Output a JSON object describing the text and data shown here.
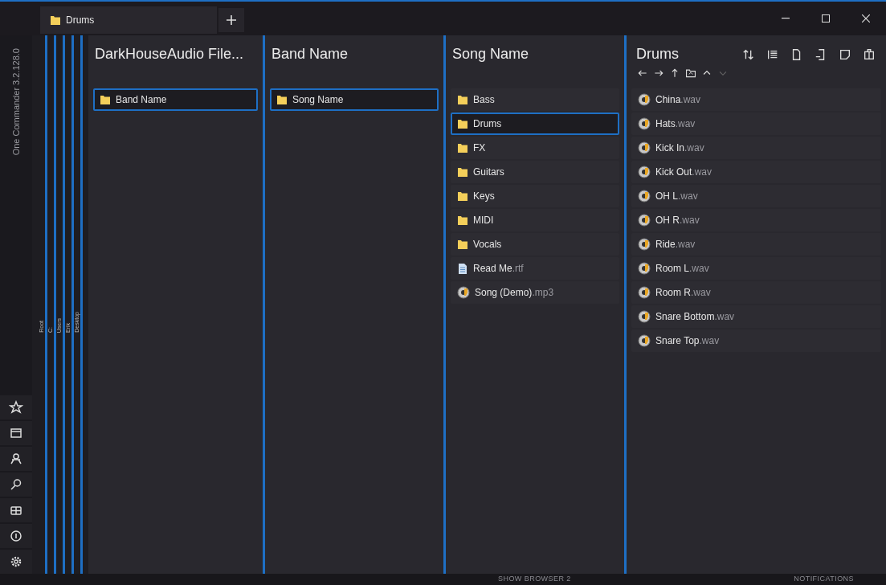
{
  "app": {
    "version_label": "One Commander 3.2.128.0"
  },
  "tabs": [
    {
      "label": "Drums",
      "selected": true
    }
  ],
  "breadcrumbs": [
    {
      "label": "Root"
    },
    {
      "label": "C:"
    },
    {
      "label": "Users"
    },
    {
      "label": "Erik"
    },
    {
      "label": "Desktop"
    }
  ],
  "columns": [
    {
      "title": "DarkHouseAudio File...",
      "items": [
        {
          "kind": "folder",
          "name": "Band Name",
          "selected": true
        }
      ]
    },
    {
      "title": "Band Name",
      "items": [
        {
          "kind": "folder",
          "name": "Song Name",
          "selected": true
        }
      ]
    },
    {
      "title": "Song Name",
      "items": [
        {
          "kind": "folder",
          "name": "Bass",
          "selected": false
        },
        {
          "kind": "folder",
          "name": "Drums",
          "selected": true
        },
        {
          "kind": "folder",
          "name": "FX",
          "selected": false
        },
        {
          "kind": "folder",
          "name": "Guitars",
          "selected": false
        },
        {
          "kind": "folder",
          "name": "Keys",
          "selected": false
        },
        {
          "kind": "folder",
          "name": "MIDI",
          "selected": false
        },
        {
          "kind": "folder",
          "name": "Vocals",
          "selected": false
        },
        {
          "kind": "document",
          "name": "Read Me",
          "ext": ".rtf",
          "selected": false
        },
        {
          "kind": "audio",
          "name": "Song (Demo)",
          "ext": ".mp3",
          "selected": false
        }
      ]
    },
    {
      "title": "Drums",
      "items": [
        {
          "kind": "audio",
          "name": "China",
          "ext": ".wav",
          "selected": false
        },
        {
          "kind": "audio",
          "name": "Hats",
          "ext": ".wav",
          "selected": false
        },
        {
          "kind": "audio",
          "name": "Kick In",
          "ext": ".wav",
          "selected": false
        },
        {
          "kind": "audio",
          "name": "Kick Out",
          "ext": ".wav",
          "selected": false
        },
        {
          "kind": "audio",
          "name": "OH L",
          "ext": ".wav",
          "selected": false
        },
        {
          "kind": "audio",
          "name": "OH R",
          "ext": ".wav",
          "selected": false
        },
        {
          "kind": "audio",
          "name": "Ride",
          "ext": ".wav",
          "selected": false
        },
        {
          "kind": "audio",
          "name": "Room L",
          "ext": ".wav",
          "selected": false
        },
        {
          "kind": "audio",
          "name": "Room R",
          "ext": ".wav",
          "selected": false
        },
        {
          "kind": "audio",
          "name": "Snare Bottom",
          "ext": ".wav",
          "selected": false
        },
        {
          "kind": "audio",
          "name": "Snare Top",
          "ext": ".wav",
          "selected": false
        }
      ]
    }
  ],
  "status_bar": {
    "left": "SHOW BROWSER 2",
    "right": "NOTIFICATIONS"
  }
}
